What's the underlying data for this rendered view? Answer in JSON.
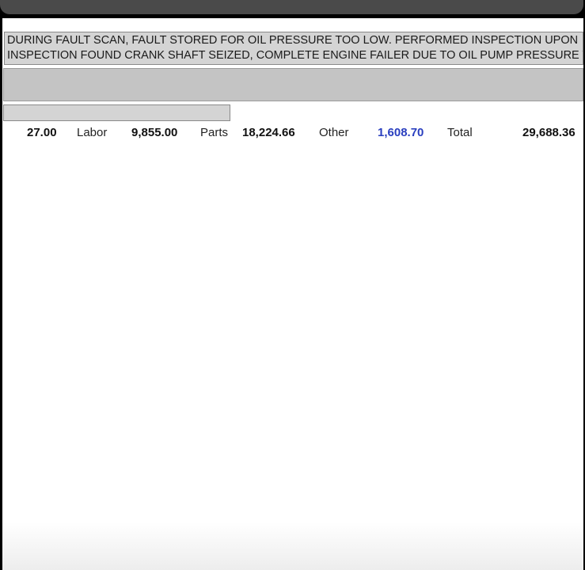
{
  "comment": {
    "line1": "DURING FAULT SCAN, FAULT STORED FOR OIL PRESSURE TOO LOW. PERFORMED INSPECTION UPON",
    "line2": "INSPECTION FOUND CRANK SHAFT SEIZED, COMPLETE ENGINE FAILER DUE TO OIL PUMP PRESSURE TOO"
  },
  "totals": {
    "hours": "27.00",
    "labor_label": "Labor",
    "labor_value": "9,855.00",
    "parts_label": "Parts",
    "parts_value": "18,224.66",
    "other_label": "Other",
    "other_value": "1,608.70",
    "total_label": "Total",
    "total_value": "29,688.36"
  },
  "colors": {
    "accent": "#2a3fbf",
    "field_bg": "#d4d4d4",
    "frame": "#4a4a4a"
  }
}
